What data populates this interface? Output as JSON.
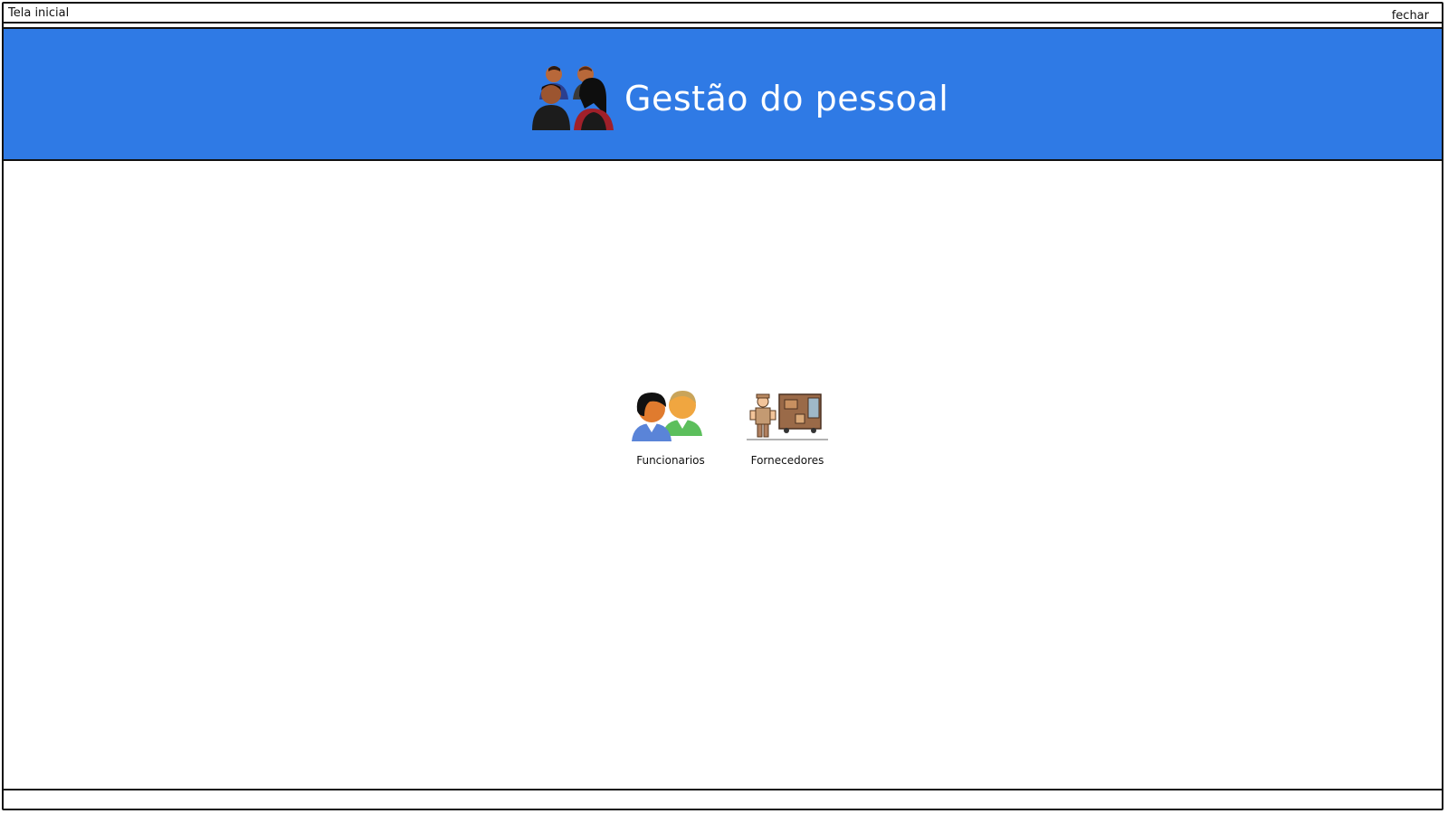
{
  "window": {
    "title": "Tela inicial",
    "close_label": "fechar"
  },
  "header": {
    "title": "Gestão do pessoal",
    "icon": "people-group-icon",
    "background_color": "#2f7ae5"
  },
  "tiles": [
    {
      "label": "Funcionarios",
      "icon": "employees-icon"
    },
    {
      "label": "Fornecedores",
      "icon": "supplier-delivery-icon"
    }
  ]
}
